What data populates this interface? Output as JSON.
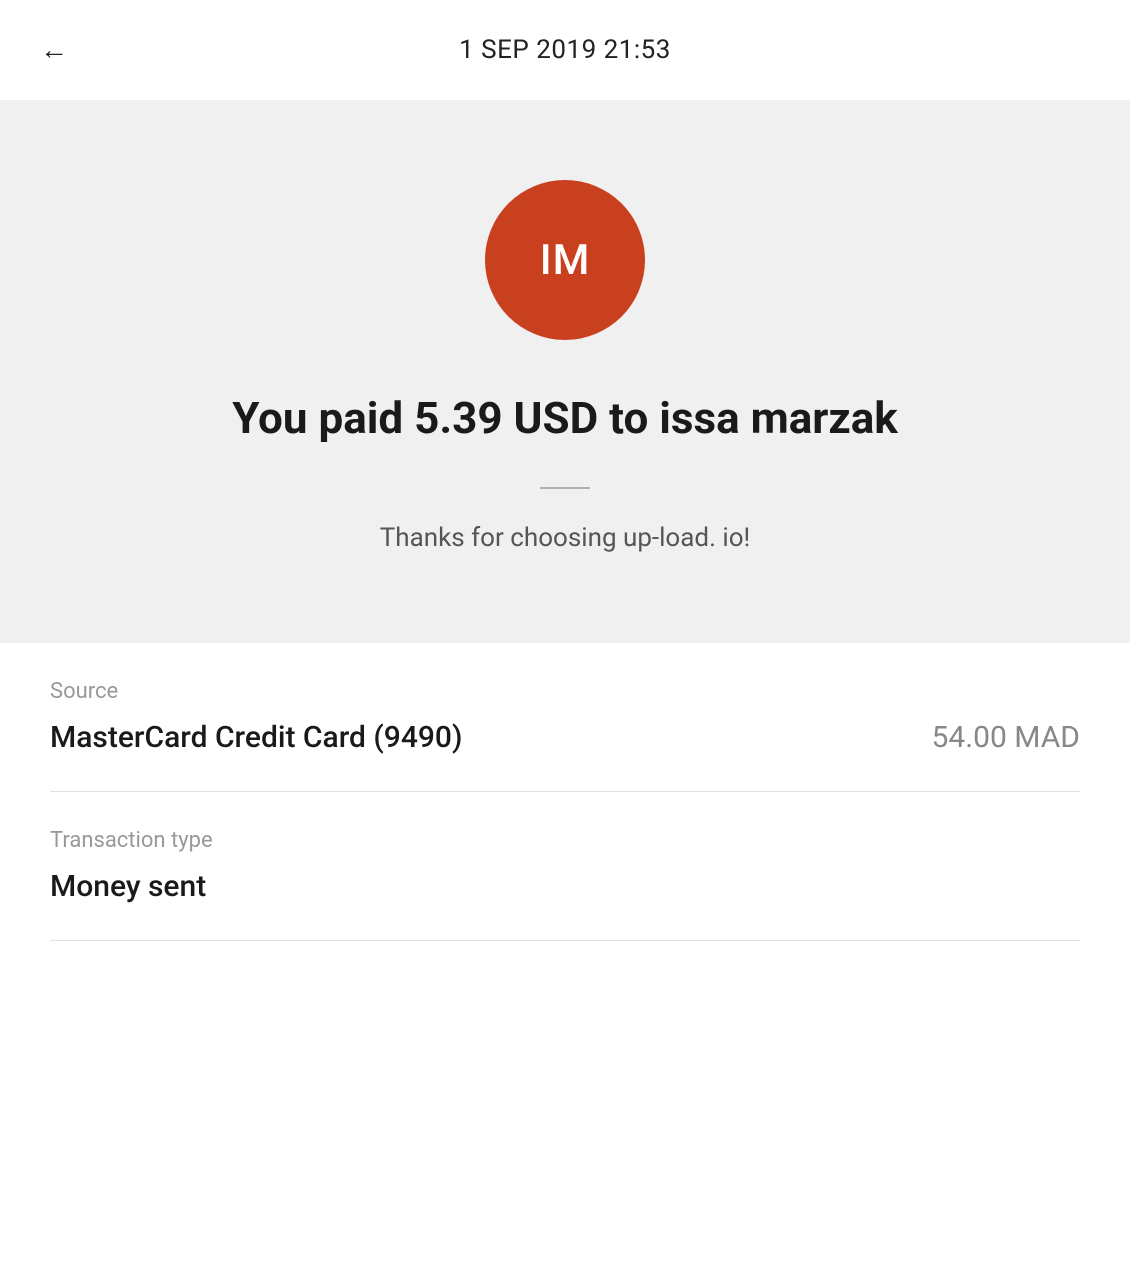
{
  "header": {
    "date": "1 SEP 2019  21:53",
    "back_label": "←"
  },
  "hero": {
    "avatar_initials": "IM",
    "avatar_bg_color": "#c8401e",
    "payment_title": "You paid 5.39 USD to issa marzak",
    "thank_you_text": "Thanks for choosing up-load. io!"
  },
  "details": {
    "source_label": "Source",
    "source_value": "MasterCard Credit Card (9490)",
    "source_amount": "54.00 MAD",
    "transaction_type_label": "Transaction type",
    "transaction_type_value": "Money sent"
  }
}
